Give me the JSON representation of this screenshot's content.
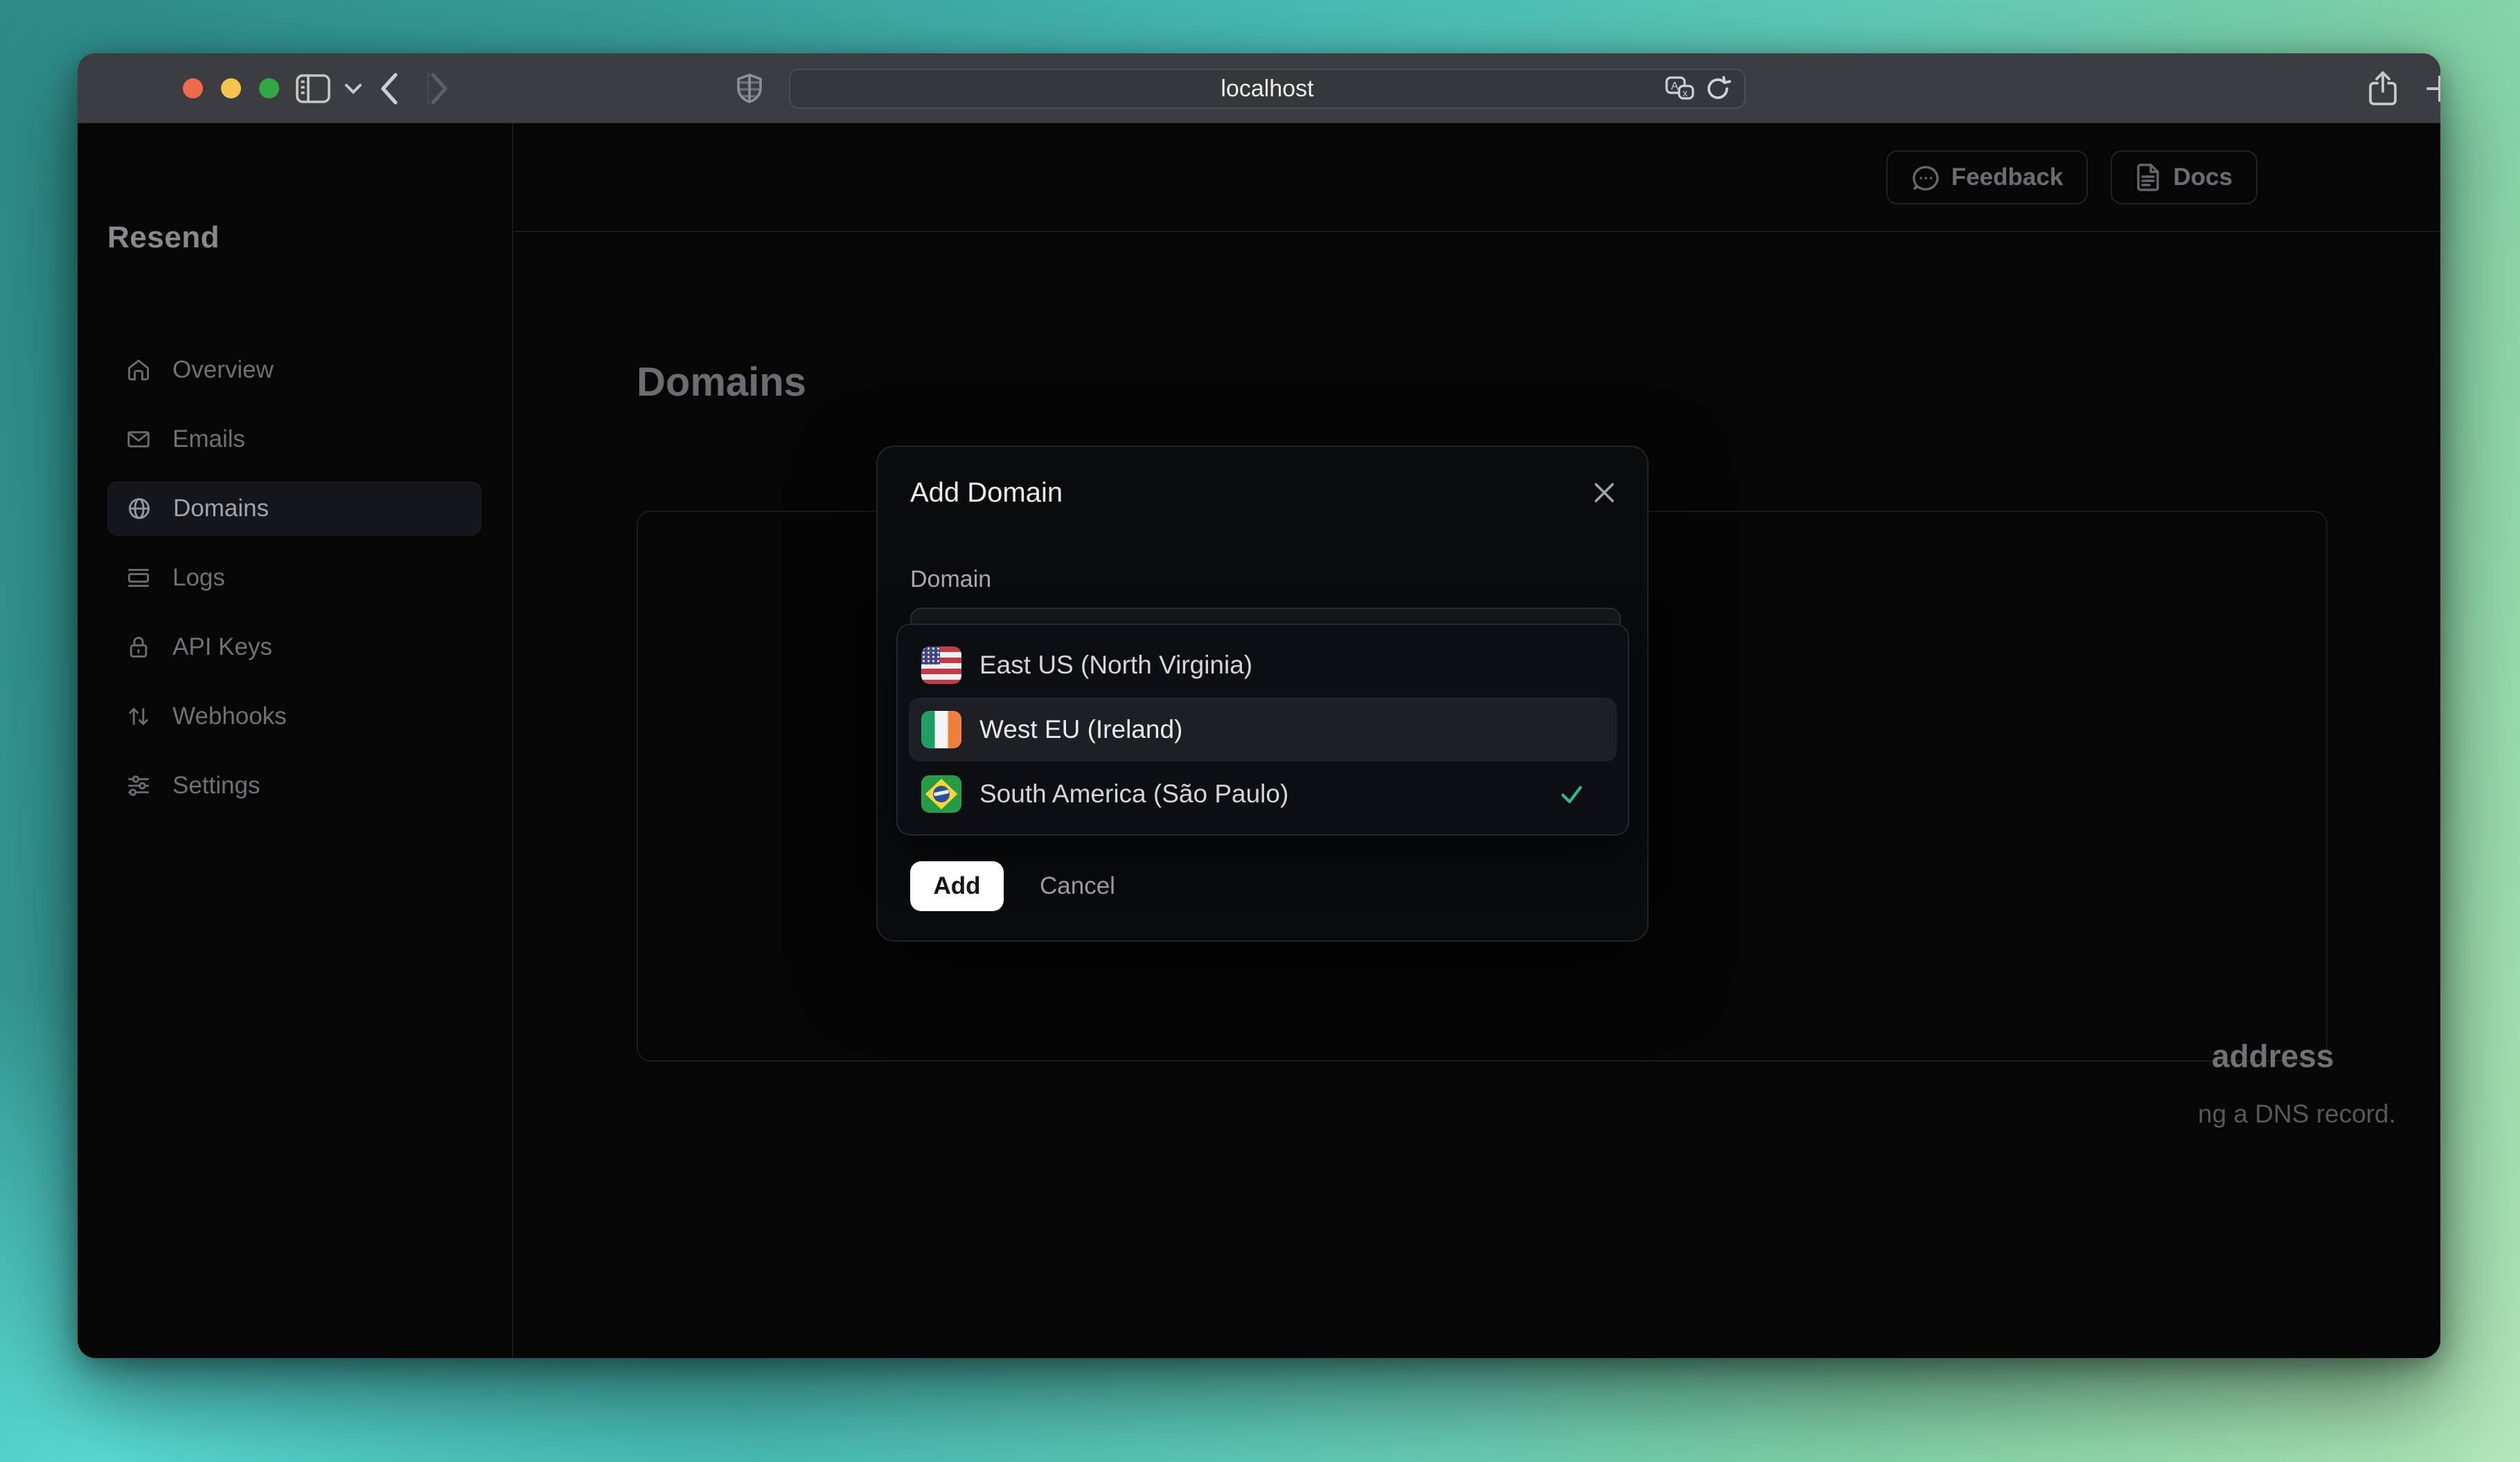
{
  "browser": {
    "url": "localhost",
    "traffic_lights": [
      "close",
      "minimize",
      "zoom"
    ],
    "toolbar_icons": [
      "sidebar-toggle",
      "chevron-down",
      "back",
      "forward",
      "shield",
      "translate",
      "reload",
      "share",
      "new-tab",
      "tab-overview"
    ]
  },
  "sidebar": {
    "logo": "Resend",
    "items": [
      {
        "label": "Overview",
        "icon": "home-icon",
        "active": false
      },
      {
        "label": "Emails",
        "icon": "mail-icon",
        "active": false
      },
      {
        "label": "Domains",
        "icon": "globe-icon",
        "active": true
      },
      {
        "label": "Logs",
        "icon": "logs-icon",
        "active": false
      },
      {
        "label": "API Keys",
        "icon": "lock-icon",
        "active": false
      },
      {
        "label": "Webhooks",
        "icon": "arrows-updown-icon",
        "active": false
      },
      {
        "label": "Settings",
        "icon": "sliders-icon",
        "active": false
      }
    ]
  },
  "header": {
    "feedback_label": "Feedback",
    "docs_label": "Docs"
  },
  "page": {
    "title": "Domains",
    "empty_card": {
      "heading_visible_fragment": "address",
      "body_visible_fragment": "ng a DNS record."
    }
  },
  "modal": {
    "title": "Add Domain",
    "close_icon": "x-icon",
    "field_label": "Domain",
    "dropdown": {
      "options": [
        {
          "label": "East US (North Virginia)",
          "flag": "us-flag",
          "hovered": false,
          "selected": false
        },
        {
          "label": "West EU (Ireland)",
          "flag": "ireland-flag",
          "hovered": true,
          "selected": false
        },
        {
          "label": "South America (São Paulo)",
          "flag": "brazil-flag",
          "hovered": false,
          "selected": true
        }
      ]
    },
    "add_label": "Add",
    "cancel_label": "Cancel"
  },
  "colors": {
    "accent_check": "#2fbe8b",
    "modal_bg": "#0a0b0d",
    "dropdown_bg": "#0d0e11",
    "hover_row_bg": "#1d1f24",
    "chrome_bg": "#3b3d41",
    "desktop_teal": "#48bcb4",
    "desktop_green": "#a6e1b1"
  }
}
